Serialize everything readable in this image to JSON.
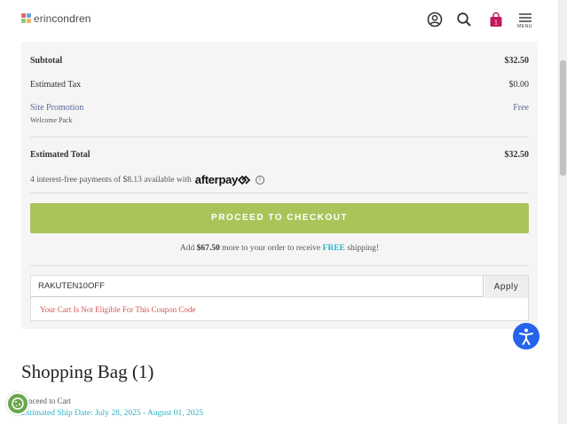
{
  "header": {
    "logo_prefix": "erin",
    "logo_suffix": "condren",
    "menu_label": "MENU",
    "cart_count": "1",
    "icons": [
      "account-icon",
      "search-icon",
      "bag-icon",
      "hamburger-menu-icon"
    ]
  },
  "summary": {
    "subtotal_label": "Subtotal",
    "subtotal_value": "$32.50",
    "tax_label": "Estimated Tax",
    "tax_value": "$0.00",
    "promo_label": "Site Promotion",
    "promo_value": "Free",
    "promo_detail": "Welcome Pack",
    "total_label": "Estimated Total",
    "total_value": "$32.50",
    "afterpay_text": "4 interest-free payments of $8.13 available with",
    "afterpay_brand": "afterpay",
    "info_glyph": "i",
    "checkout_label": "PROCEED TO CHECKOUT",
    "shipping_prefix": "Add",
    "shipping_amount": "$67.50",
    "shipping_middle": "more to your order to receive",
    "shipping_free": "FREE",
    "shipping_suffix": "shipping!"
  },
  "coupon": {
    "value": "RAKUTEN10OFF",
    "apply_label": "Apply",
    "error": "Your Cart Is Not Eligible For This Coupon Code"
  },
  "bag": {
    "title": "Shopping Bag (1)",
    "proceed_text": "Proceed to Cart",
    "ship_date": "Estimated Ship Date: July 28, 2025 - August 01, 2025"
  },
  "colors": {
    "checkout_green": "#a9c55a",
    "accent_teal": "#2eb1c4",
    "error_red": "#d9534f",
    "promo_blue": "#5a6a9a",
    "cart_badge": "#c2185b",
    "a11y_blue": "#2563eb"
  }
}
